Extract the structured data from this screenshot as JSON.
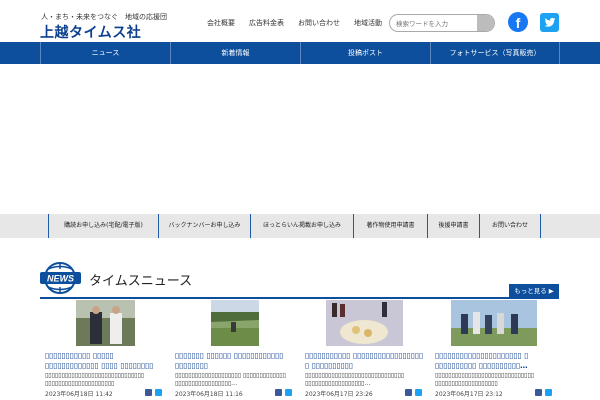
{
  "header": {
    "tagline": "人・まち・未来をつなぐ　地域の応援団",
    "logo": "上越タイムス社",
    "links": [
      "会社概要",
      "広告料金表",
      "お問い合わせ",
      "地域活動"
    ],
    "search_placeholder": "検索ワードを入力",
    "facebook_letter": "f"
  },
  "main_nav": [
    "ニュース",
    "新着情報",
    "投稿ポスト",
    "フォトサービス（写真販売）"
  ],
  "sub_nav": [
    "購読お申し込み(宅配/電子版)",
    "バックナンバーお申し込み",
    "ほっとらいん掲載お申し込み",
    "著作物使用申請書",
    "後援申請書",
    "お問い合わせ"
  ],
  "news": {
    "badge": "NEWS",
    "title": "タイムスニュース",
    "more": "もっと見る ▶",
    "cards": [
      {
        "title": "▯▯▯▯▯▯▯▯▯▯▯ ▯▯▯▯▯ ▯▯▯▯▯▯▯▯▯▯▯▯▯ ▯▯▯▯ ▯▯▯▯▯▯▯▯ ▯▯▯▯▯▯▯▯…",
        "body": "▯▯▯▯▯▯▯▯▯▯▯▯▯▯▯▯▯▯▯▯▯▯▯▯▯▯▯▯▯▯ ▯▯▯▯▯▯▯▯▯▯▯▯▯▯▯▯▯▯▯▯▯",
        "date": "2023年06月18日 11:42"
      },
      {
        "title": "▯▯▯▯▯▯▯ ▯▯▯▯▯▯ ▯▯▯▯▯▯▯▯▯▯▯▯ ▯▯▯▯▯▯▯▯",
        "body": "▯▯▯▯▯▯▯▯▯▯▯▯▯▯▯▯▯▯▯▯ ▯▯▯▯▯▯▯▯▯▯▯▯▯ ▯▯▯▯▯▯▯▯▯▯▯▯▯▯▯▯▯…",
        "date": "2023年06月18日 11:16"
      },
      {
        "title": "▯▯▯▯▯▯▯▯▯▯▯ ▯▯▯▯▯▯▯▯▯▯▯▯▯▯▯▯▯ ▯ ▯▯▯▯▯▯▯▯▯▯",
        "body": "▯▯▯▯▯▯▯▯▯▯▯▯▯▯▯▯▯▯▯▯▯▯▯▯▯▯▯▯▯▯ ▯▯▯▯▯▯▯▯▯▯▯▯▯▯▯▯▯▯…",
        "date": "2023年06月17日 23:26"
      },
      {
        "title": "▯▯▯▯▯▯▯▯▯▯▯▯▯▯▯▯▯▯▯▯▯ ▯ ▯▯▯▯▯▯▯▯▯▯ ▯▯▯▯▯▯▯▯▯▯…",
        "body": "▯▯▯▯▯▯▯▯▯▯▯▯▯▯▯▯▯▯▯▯▯▯▯▯▯▯▯▯▯▯ ▯▯▯▯▯▯▯▯▯▯▯▯▯▯▯▯▯▯▯",
        "date": "2023年06月17日 23:12"
      }
    ]
  },
  "colors": {
    "nav_blue": "#0d4f9c",
    "logo_blue": "#0d3f8f",
    "facebook": "#1877f2",
    "twitter": "#1da1f2",
    "subnav_bg": "#e7e7e7"
  }
}
